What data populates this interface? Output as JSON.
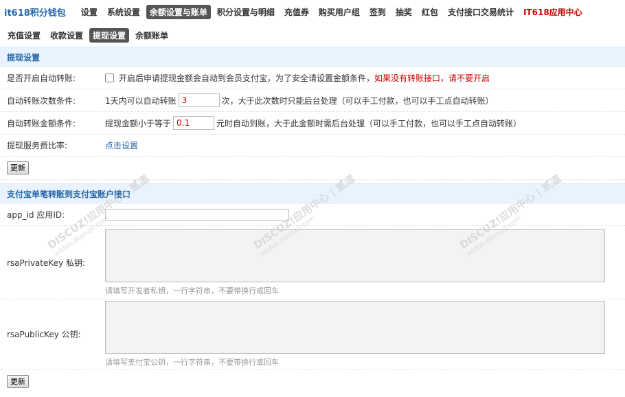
{
  "brand": "it618积分钱包",
  "topnav": [
    {
      "label": "设置",
      "active": false,
      "highlight": false
    },
    {
      "label": "系统设置",
      "active": false,
      "highlight": false
    },
    {
      "label": "余额设置与账单",
      "active": true,
      "highlight": false
    },
    {
      "label": "积分设置与明细",
      "active": false,
      "highlight": false
    },
    {
      "label": "充值券",
      "active": false,
      "highlight": false
    },
    {
      "label": "购买用户组",
      "active": false,
      "highlight": false
    },
    {
      "label": "签到",
      "active": false,
      "highlight": false
    },
    {
      "label": "抽奖",
      "active": false,
      "highlight": false
    },
    {
      "label": "红包",
      "active": false,
      "highlight": false
    },
    {
      "label": "支付接口交易统计",
      "active": false,
      "highlight": false
    },
    {
      "label": "IT618应用中心",
      "active": false,
      "highlight": true
    }
  ],
  "subnav": [
    {
      "label": "充值设置",
      "active": false
    },
    {
      "label": "收款设置",
      "active": false
    },
    {
      "label": "提现设置",
      "active": true
    },
    {
      "label": "余额账单",
      "active": false
    }
  ],
  "section1": {
    "title": "提现设置",
    "auto_transfer": {
      "label": "是否开启自动转账:",
      "desc": "开启后申请提现金额会自动到会员支付宝，为了安全请设置金额条件，",
      "warning": "如果没有转账接口，请不要开启",
      "checked": false
    },
    "count_condition": {
      "label": "自动转账次数条件:",
      "prefix": "1天内可以自动转账",
      "value": "3",
      "suffix": "次，大于此次数时只能后台处理（可以手工付款，也可以手工点自动转账）"
    },
    "amount_condition": {
      "label": "自动转账金额条件:",
      "prefix": "提现金额小于等于",
      "value": "0.1",
      "suffix": "元时自动到账，大于此金额时需后台处理（可以手工付款，也可以手工点自动转账）"
    },
    "fee_ratio": {
      "label": "提现服务费比率:",
      "link": "点击设置"
    },
    "submit_label": "更新"
  },
  "section2": {
    "title": "支付宝单笔转账到支付宝账户接口",
    "app_id": {
      "label": "app_id 应用ID:",
      "value": ""
    },
    "private_key": {
      "label": "rsaPrivateKey 私钥:",
      "hint": "请填写开发者私钥，一行字符串，不要带换行或回车"
    },
    "public_key": {
      "label": "rsaPublicKey 公钥:",
      "hint": "请填写支付宝公钥，一行字符串，不要带换行或回车"
    },
    "submit_label": "更新"
  },
  "watermark": {
    "line1": "DISCUZ!应用中心 | 贰道",
    "line2": "addon.dismall.com"
  }
}
